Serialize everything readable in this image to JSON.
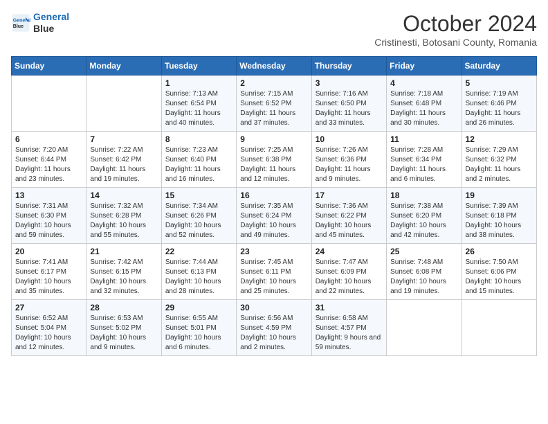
{
  "header": {
    "logo_line1": "General",
    "logo_line2": "Blue",
    "month_title": "October 2024",
    "subtitle": "Cristinesti, Botosani County, Romania"
  },
  "days_of_week": [
    "Sunday",
    "Monday",
    "Tuesday",
    "Wednesday",
    "Thursday",
    "Friday",
    "Saturday"
  ],
  "weeks": [
    [
      {
        "day": "",
        "info": ""
      },
      {
        "day": "",
        "info": ""
      },
      {
        "day": "1",
        "info": "Sunrise: 7:13 AM\nSunset: 6:54 PM\nDaylight: 11 hours and 40 minutes."
      },
      {
        "day": "2",
        "info": "Sunrise: 7:15 AM\nSunset: 6:52 PM\nDaylight: 11 hours and 37 minutes."
      },
      {
        "day": "3",
        "info": "Sunrise: 7:16 AM\nSunset: 6:50 PM\nDaylight: 11 hours and 33 minutes."
      },
      {
        "day": "4",
        "info": "Sunrise: 7:18 AM\nSunset: 6:48 PM\nDaylight: 11 hours and 30 minutes."
      },
      {
        "day": "5",
        "info": "Sunrise: 7:19 AM\nSunset: 6:46 PM\nDaylight: 11 hours and 26 minutes."
      }
    ],
    [
      {
        "day": "6",
        "info": "Sunrise: 7:20 AM\nSunset: 6:44 PM\nDaylight: 11 hours and 23 minutes."
      },
      {
        "day": "7",
        "info": "Sunrise: 7:22 AM\nSunset: 6:42 PM\nDaylight: 11 hours and 19 minutes."
      },
      {
        "day": "8",
        "info": "Sunrise: 7:23 AM\nSunset: 6:40 PM\nDaylight: 11 hours and 16 minutes."
      },
      {
        "day": "9",
        "info": "Sunrise: 7:25 AM\nSunset: 6:38 PM\nDaylight: 11 hours and 12 minutes."
      },
      {
        "day": "10",
        "info": "Sunrise: 7:26 AM\nSunset: 6:36 PM\nDaylight: 11 hours and 9 minutes."
      },
      {
        "day": "11",
        "info": "Sunrise: 7:28 AM\nSunset: 6:34 PM\nDaylight: 11 hours and 6 minutes."
      },
      {
        "day": "12",
        "info": "Sunrise: 7:29 AM\nSunset: 6:32 PM\nDaylight: 11 hours and 2 minutes."
      }
    ],
    [
      {
        "day": "13",
        "info": "Sunrise: 7:31 AM\nSunset: 6:30 PM\nDaylight: 10 hours and 59 minutes."
      },
      {
        "day": "14",
        "info": "Sunrise: 7:32 AM\nSunset: 6:28 PM\nDaylight: 10 hours and 55 minutes."
      },
      {
        "day": "15",
        "info": "Sunrise: 7:34 AM\nSunset: 6:26 PM\nDaylight: 10 hours and 52 minutes."
      },
      {
        "day": "16",
        "info": "Sunrise: 7:35 AM\nSunset: 6:24 PM\nDaylight: 10 hours and 49 minutes."
      },
      {
        "day": "17",
        "info": "Sunrise: 7:36 AM\nSunset: 6:22 PM\nDaylight: 10 hours and 45 minutes."
      },
      {
        "day": "18",
        "info": "Sunrise: 7:38 AM\nSunset: 6:20 PM\nDaylight: 10 hours and 42 minutes."
      },
      {
        "day": "19",
        "info": "Sunrise: 7:39 AM\nSunset: 6:18 PM\nDaylight: 10 hours and 38 minutes."
      }
    ],
    [
      {
        "day": "20",
        "info": "Sunrise: 7:41 AM\nSunset: 6:17 PM\nDaylight: 10 hours and 35 minutes."
      },
      {
        "day": "21",
        "info": "Sunrise: 7:42 AM\nSunset: 6:15 PM\nDaylight: 10 hours and 32 minutes."
      },
      {
        "day": "22",
        "info": "Sunrise: 7:44 AM\nSunset: 6:13 PM\nDaylight: 10 hours and 28 minutes."
      },
      {
        "day": "23",
        "info": "Sunrise: 7:45 AM\nSunset: 6:11 PM\nDaylight: 10 hours and 25 minutes."
      },
      {
        "day": "24",
        "info": "Sunrise: 7:47 AM\nSunset: 6:09 PM\nDaylight: 10 hours and 22 minutes."
      },
      {
        "day": "25",
        "info": "Sunrise: 7:48 AM\nSunset: 6:08 PM\nDaylight: 10 hours and 19 minutes."
      },
      {
        "day": "26",
        "info": "Sunrise: 7:50 AM\nSunset: 6:06 PM\nDaylight: 10 hours and 15 minutes."
      }
    ],
    [
      {
        "day": "27",
        "info": "Sunrise: 6:52 AM\nSunset: 5:04 PM\nDaylight: 10 hours and 12 minutes."
      },
      {
        "day": "28",
        "info": "Sunrise: 6:53 AM\nSunset: 5:02 PM\nDaylight: 10 hours and 9 minutes."
      },
      {
        "day": "29",
        "info": "Sunrise: 6:55 AM\nSunset: 5:01 PM\nDaylight: 10 hours and 6 minutes."
      },
      {
        "day": "30",
        "info": "Sunrise: 6:56 AM\nSunset: 4:59 PM\nDaylight: 10 hours and 2 minutes."
      },
      {
        "day": "31",
        "info": "Sunrise: 6:58 AM\nSunset: 4:57 PM\nDaylight: 9 hours and 59 minutes."
      },
      {
        "day": "",
        "info": ""
      },
      {
        "day": "",
        "info": ""
      }
    ]
  ]
}
